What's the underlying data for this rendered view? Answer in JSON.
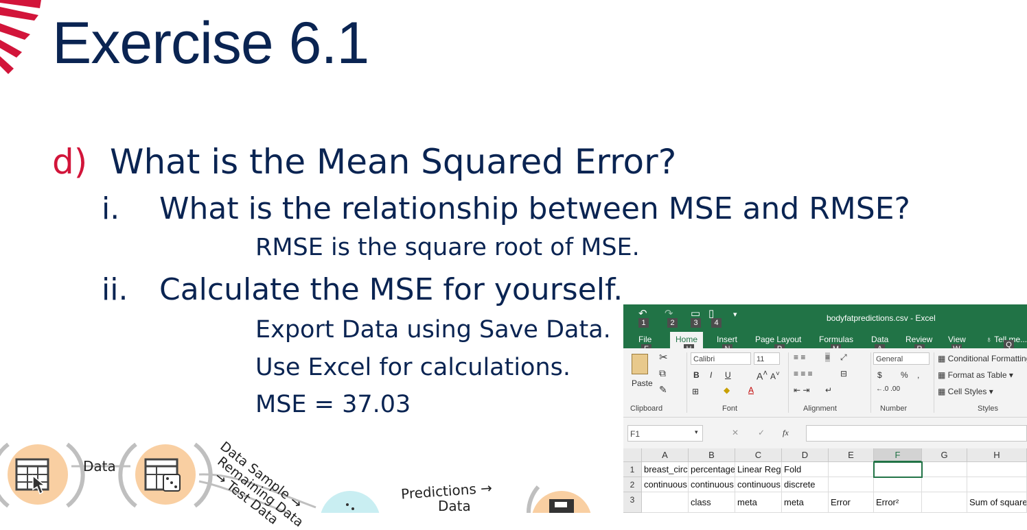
{
  "slide": {
    "title": "Exercise 6.1",
    "question_d": {
      "marker": "d)",
      "text": "What is the Mean Squared Error?"
    },
    "question_i": {
      "marker": "i.",
      "text": "What is the relationship between MSE and RMSE?"
    },
    "answer_i": "RMSE is the square root of MSE.",
    "question_ii": {
      "marker": "ii.",
      "text": "Calculate the MSE for yourself."
    },
    "answer_ii": [
      "Export Data using Save Data.",
      "Use Excel for calculations.",
      "MSE = 37.03"
    ]
  },
  "colors": {
    "title": "#0a2452",
    "accent": "#d2153a",
    "excel_green": "#217346",
    "widget_orange": "#f9cfa2"
  },
  "workflow": {
    "labels": {
      "data": "Data",
      "data_sample": "Data Sample →",
      "remaining": "Remaining Data",
      "test_data": "→ Test Data",
      "predictions": "Predictions →",
      "predictions_2": "Data"
    },
    "icons": [
      "file-widget-icon",
      "data-sampler-icon",
      "predictions-widget-icon",
      "save-data-icon"
    ]
  },
  "excel": {
    "window_title": "bodyfatpredictions.csv - Excel",
    "quick_access_keys": [
      "1",
      "2",
      "3",
      "4"
    ],
    "tabs": [
      "File",
      "Home",
      "Insert",
      "Page Layout",
      "Formulas",
      "Data",
      "Review",
      "View",
      "Tell me..."
    ],
    "tab_keys": [
      "F",
      "H",
      "N",
      "P",
      "M",
      "A",
      "R",
      "W",
      "Q"
    ],
    "ribbon": {
      "paste_label": "Paste",
      "font_name": "Calibri",
      "font_size": "11",
      "number_format": "General",
      "conditional_formatting": "Conditional Formatting",
      "format_as_table": "Format as Table",
      "cell_styles": "Cell Styles",
      "groups": [
        "Clipboard",
        "Font",
        "Alignment",
        "Number",
        "Styles"
      ],
      "bold": "B",
      "italic": "I",
      "underline": "U",
      "currency": "$",
      "percent": "%",
      "comma": ","
    },
    "name_box": "F1",
    "fx": "fx",
    "columns": [
      "A",
      "B",
      "C",
      "D",
      "E",
      "F",
      "G",
      "H"
    ],
    "rows": [
      {
        "num": "1",
        "cells": [
          "breast_circ",
          "percentage",
          "Linear Reg",
          "Fold",
          "",
          "",
          "",
          ""
        ]
      },
      {
        "num": "2",
        "cells": [
          "continuous",
          "continuous",
          "continuous",
          "discrete",
          "",
          "",
          "",
          ""
        ]
      },
      {
        "num": "3",
        "cells": [
          "",
          "class",
          "meta",
          "meta",
          "Error",
          "Error²",
          "",
          "Sum of squares"
        ]
      }
    ]
  }
}
